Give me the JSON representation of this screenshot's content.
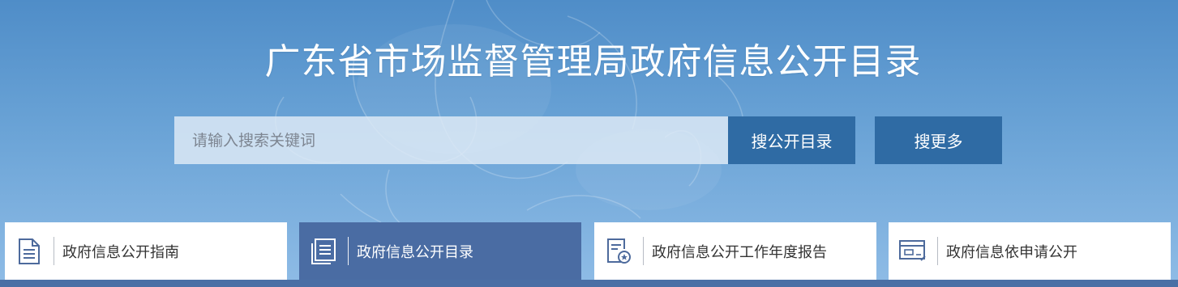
{
  "header": {
    "title": "广东省市场监督管理局政府信息公开目录"
  },
  "search": {
    "placeholder": "请输入搜索关键词",
    "value": "",
    "catalog_button_label": "搜公开目录",
    "more_button_label": "搜更多"
  },
  "nav": {
    "items": [
      {
        "label": "政府信息公开指南",
        "icon": "document-lines-icon",
        "active": false
      },
      {
        "label": "政府信息公开目录",
        "icon": "catalog-list-icon",
        "active": true
      },
      {
        "label": "政府信息公开工作年度报告",
        "icon": "report-badge-icon",
        "active": false
      },
      {
        "label": "政府信息依申请公开",
        "icon": "application-form-icon",
        "active": false
      }
    ]
  },
  "colors": {
    "button_bg": "#2f6ba4",
    "active_card_bg": "#4a6ca3",
    "bottom_bar": "#4a6fa5",
    "icon_color": "#4d6a9c"
  }
}
